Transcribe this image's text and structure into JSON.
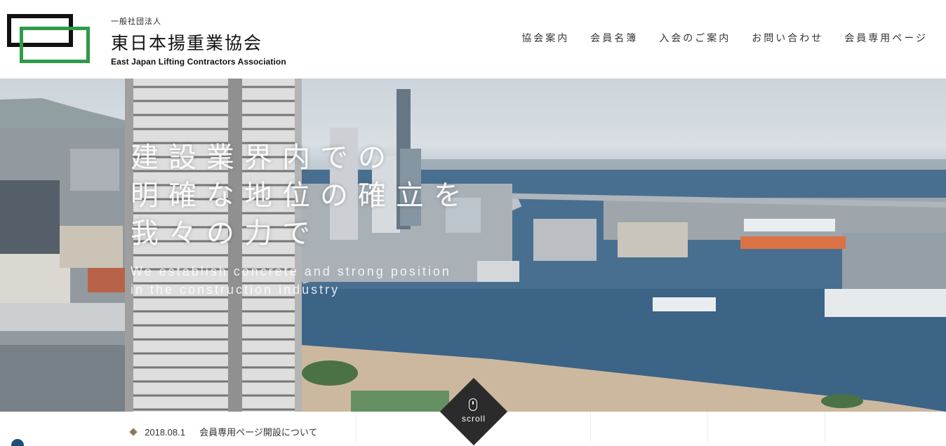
{
  "header": {
    "org_type": "一般社団法人",
    "org_name": "東日本揚重業協会",
    "org_name_en": "East Japan Lifting Contractors Association"
  },
  "nav": {
    "items": [
      "協会案内",
      "会員名簿",
      "入会のご案内",
      "お問い合わせ",
      "会員専用ページ"
    ]
  },
  "hero": {
    "lines": [
      "建設業界内での",
      "明確な地位の確立を",
      "我々の力で"
    ],
    "english_lines": [
      "We establish concrete and strong position",
      "in the construction industry"
    ]
  },
  "scroll": {
    "label": "scroll",
    "icon": "mouse-icon"
  },
  "news": {
    "items": [
      {
        "date": "2018.08.1",
        "title": "会員専用ページ開設について"
      }
    ]
  },
  "colors": {
    "logo_black": "#111111",
    "logo_green": "#2f9a48",
    "bullet": "#8a7a5a",
    "scroll_bg": "#2b2b2b"
  }
}
